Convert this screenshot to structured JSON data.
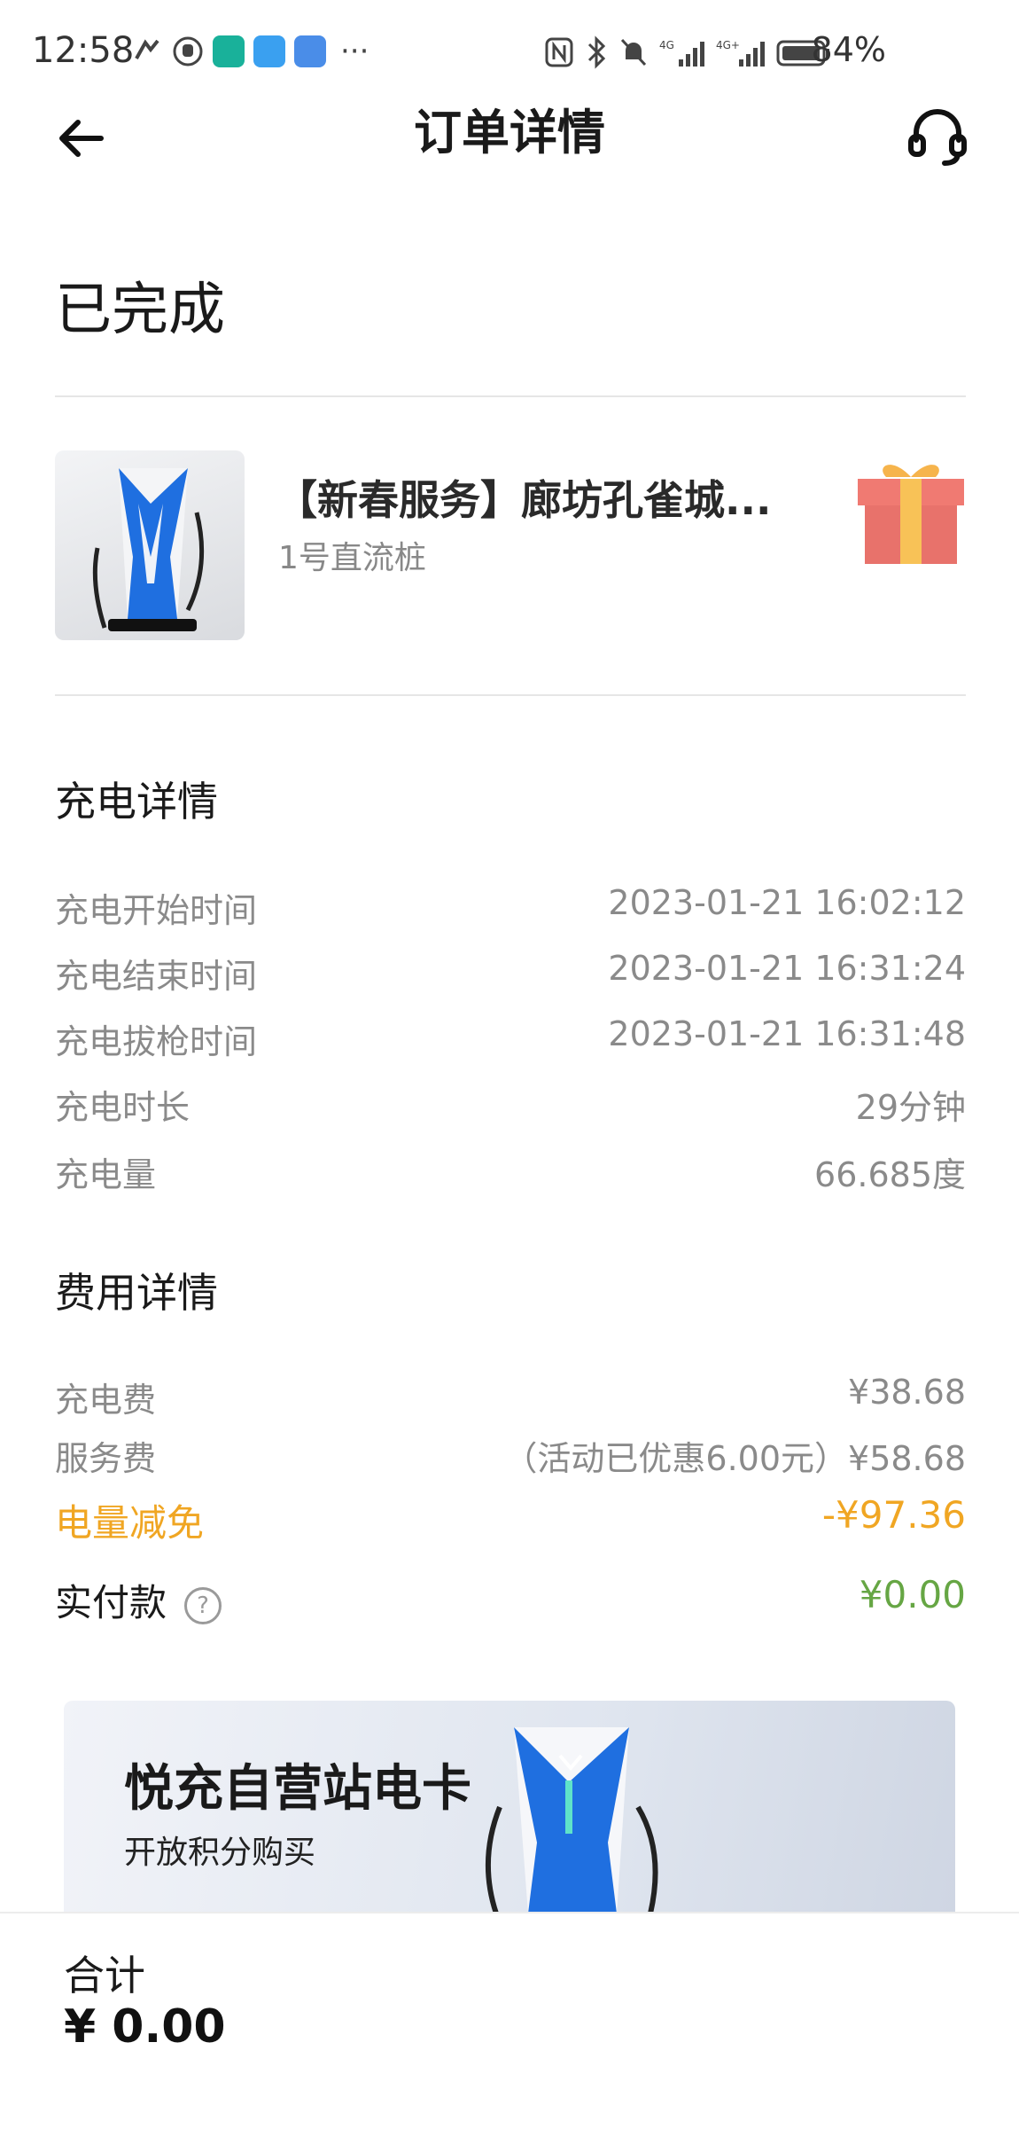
{
  "status_bar": {
    "time": "12:58",
    "more": "···",
    "battery_percent": "84%",
    "network_1": "4G",
    "network_2": "4G+"
  },
  "nav": {
    "title": "订单详情"
  },
  "order": {
    "status": "已完成"
  },
  "station": {
    "name": "【新春服务】廊坊孔雀城...",
    "charger": "1号直流桩"
  },
  "charging": {
    "title": "充电详情",
    "rows": [
      {
        "label": "充电开始时间",
        "value": "2023-01-21 16:02:12"
      },
      {
        "label": "充电结束时间",
        "value": "2023-01-21 16:31:24"
      },
      {
        "label": "充电拔枪时间",
        "value": "2023-01-21 16:31:48"
      },
      {
        "label": "充电时长",
        "value": "29分钟"
      },
      {
        "label": "充电量",
        "value": "66.685度"
      }
    ]
  },
  "fees": {
    "title": "费用详情",
    "charge_fee": {
      "label": "充电费",
      "value": "¥38.68"
    },
    "service_fee": {
      "label": "服务费",
      "value": "（活动已优惠6.00元）¥58.68"
    },
    "discount": {
      "label": "电量减免",
      "value": "-¥97.36"
    },
    "paid": {
      "label": "实付款",
      "value": "¥0.00"
    }
  },
  "banner": {
    "title": "悦充自营站电卡",
    "subtitle": "开放积分购买"
  },
  "footer": {
    "total_label": "合计",
    "total_value": "¥ 0.00"
  },
  "colors": {
    "discount": "#f0a623",
    "paid": "#66a644",
    "muted_text": "#8a8a8a",
    "charger_blue": "#1f6fe0"
  }
}
